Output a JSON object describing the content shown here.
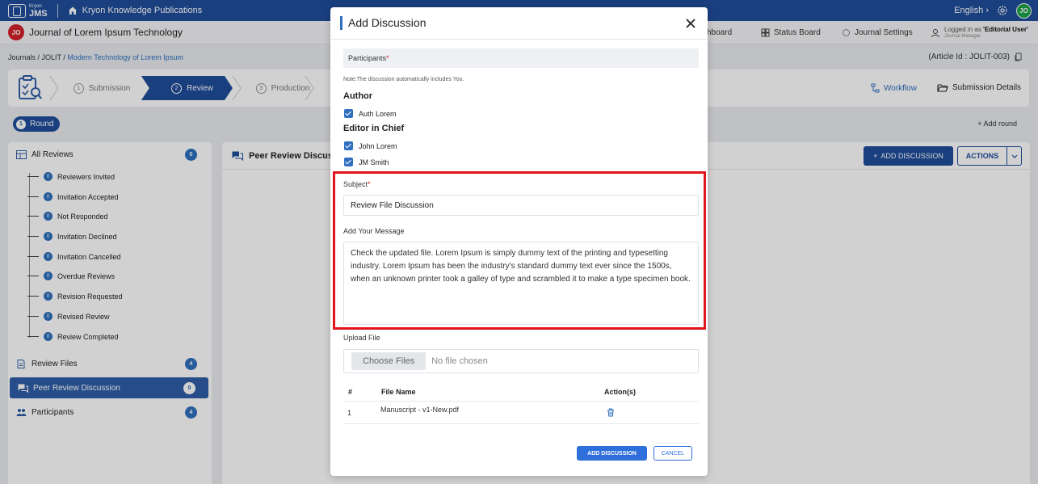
{
  "topbar": {
    "brand_small": "Kryon",
    "brand_big": "JMS",
    "publication": "Kryon Knowledge Publications",
    "language": "English",
    "user_initials": "JO"
  },
  "journal_bar": {
    "badge": "JO",
    "title": "Journal of Lorem Ipsum Technology",
    "nav": {
      "dashboard": "shboard",
      "status_board": "Status Board",
      "journal_settings": "Journal Settings"
    },
    "logged_prefix": "Logged in as ",
    "logged_role": "'Editorial User'",
    "logged_sub": "Journal Manager"
  },
  "breadcrumb": {
    "root": "Journals",
    "journal": "JOLIT",
    "current": "Modern Technology of Lorem Ipsum"
  },
  "article_id": "(Article Id : JOLIT-003)",
  "stepper": {
    "steps": [
      {
        "num": "1",
        "label": "Submission"
      },
      {
        "num": "2",
        "label": "Review"
      },
      {
        "num": "3",
        "label": "Production"
      }
    ],
    "workflow": "Workflow",
    "submission_details": "Submission Details"
  },
  "round": {
    "num": "1",
    "label": "Round",
    "add": "+ Add round"
  },
  "sidebar": {
    "all_reviews": {
      "label": "All Reviews",
      "count": "0"
    },
    "sub_items": [
      {
        "count": "0",
        "label": "Reviewers Invited"
      },
      {
        "count": "0",
        "label": "Invitation Accepted"
      },
      {
        "count": "0",
        "label": "Not Responded"
      },
      {
        "count": "0",
        "label": "Invitation Declined"
      },
      {
        "count": "0",
        "label": "Invitation Cancelled"
      },
      {
        "count": "0",
        "label": "Overdue Reviews"
      },
      {
        "count": "0",
        "label": "Revision Requested"
      },
      {
        "count": "0",
        "label": "Revised Review"
      },
      {
        "count": "0",
        "label": "Review Completed"
      }
    ],
    "review_files": {
      "label": "Review Files",
      "count": "4"
    },
    "peer_review": {
      "label": "Peer Review Discussion",
      "count": "0"
    },
    "participants": {
      "label": "Participants",
      "count": "4"
    }
  },
  "content": {
    "heading": "Peer Review Discuss",
    "add_discussion": "ADD DISCUSSION",
    "add_plus": "+",
    "actions": "ACTIONS"
  },
  "modal": {
    "title": "Add Discussion",
    "participants_label": "Participants",
    "required_mark": "*",
    "note": "Note:The discussion automatically includes You.",
    "groups": [
      {
        "title": "Author",
        "members": [
          "Auth Lorem"
        ]
      },
      {
        "title": "Editor in Chief",
        "members": [
          "John Lorem",
          "JM Smith"
        ]
      }
    ],
    "subject_label": "Subject",
    "subject_value": "Review File Discussion",
    "message_label": "Add Your Message",
    "message_value": "Check the updated file. Lorem Ipsum is simply dummy text of the printing and typesetting industry. Lorem Ipsum has been the industry's standard dummy text ever since the 1500s, when an unknown printer took a galley of type and scrambled it to make a type specimen book.",
    "upload_label": "Upload File",
    "choose_files": "Choose Files",
    "no_file": "No file chosen",
    "table": {
      "headers": [
        "#",
        "File Name",
        "Action(s)"
      ],
      "rows": [
        {
          "index": "1",
          "file": "Manuscript - v1-New.pdf"
        }
      ]
    },
    "submit": "ADD DISCUSSION",
    "cancel": "CANCEL"
  },
  "colors": {
    "brand": "#1f4e9c",
    "accent": "#2f6fbf",
    "highlight": "#e0141c"
  }
}
